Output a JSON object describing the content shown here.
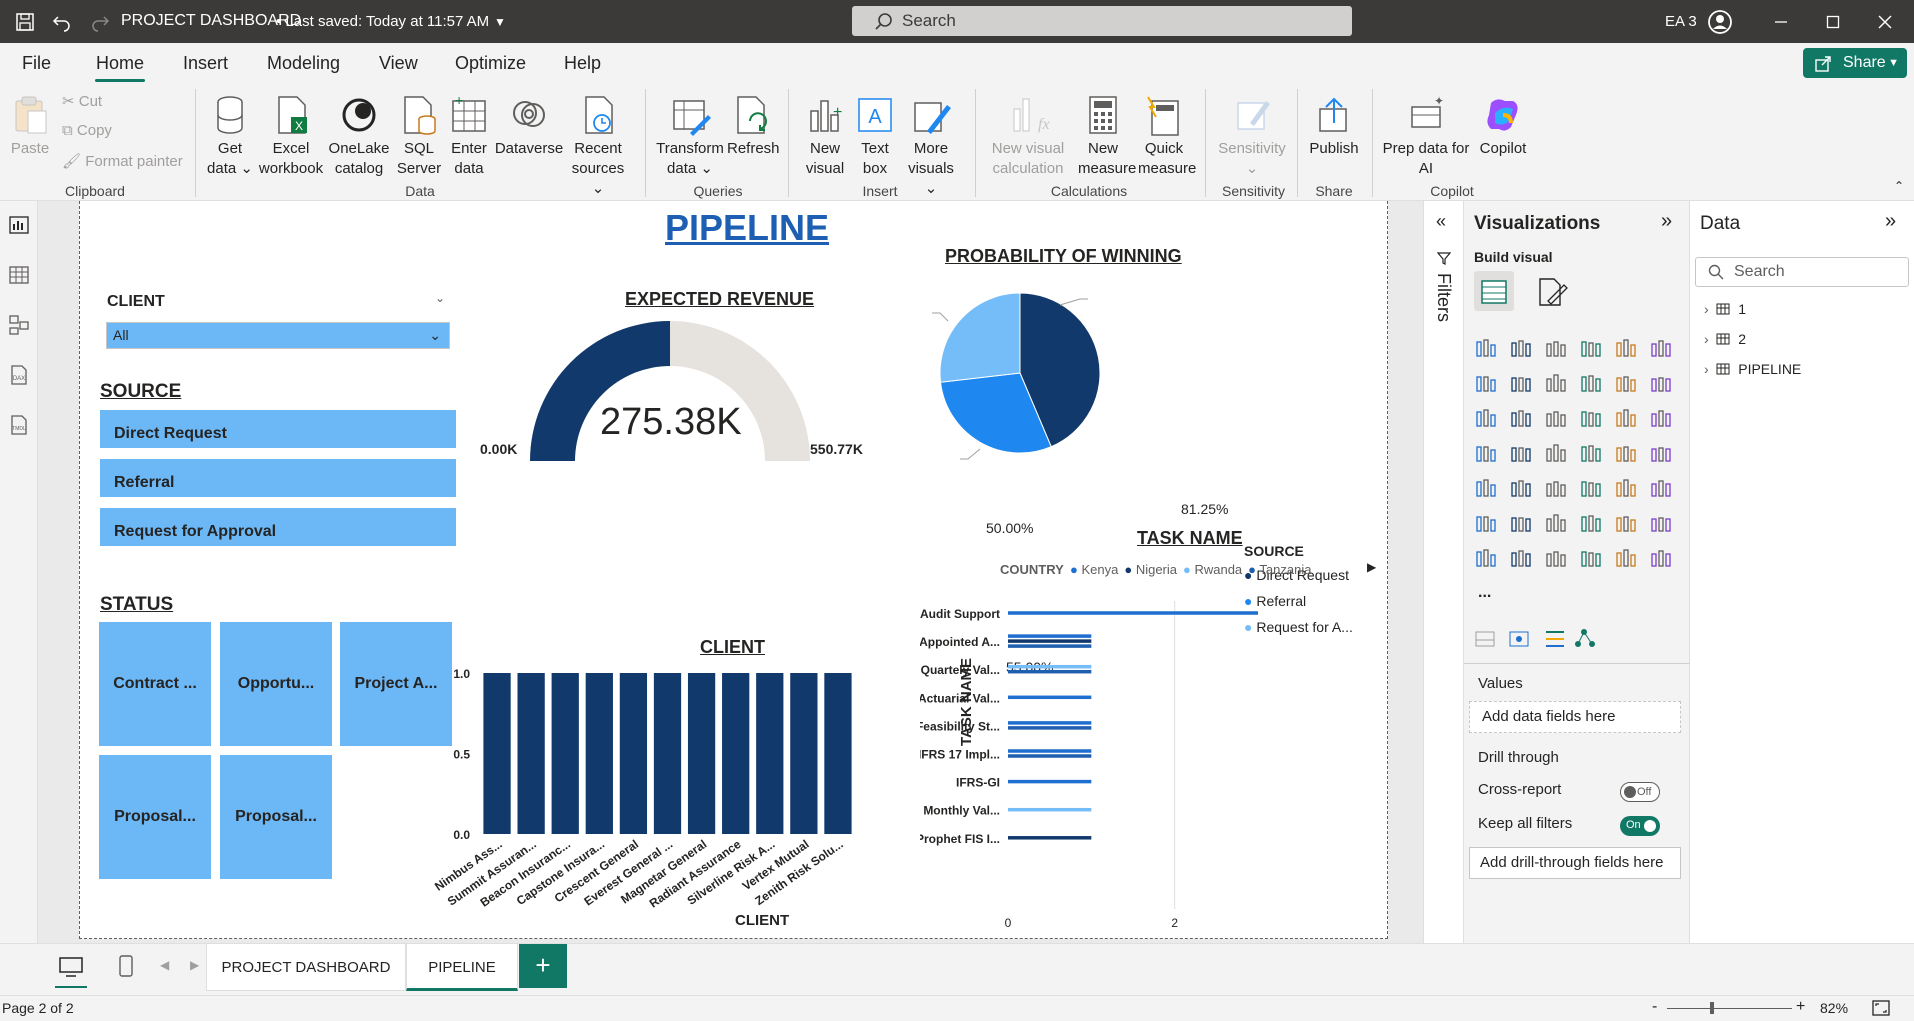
{
  "titlebar": {
    "title": "PROJECT DASHBOARD",
    "saved": "• Last saved: Today at 11:57 AM",
    "search_placeholder": "Search",
    "user": "EA 3"
  },
  "menu": {
    "items": [
      "File",
      "Home",
      "Insert",
      "Modeling",
      "View",
      "Optimize",
      "Help"
    ],
    "active": "Home",
    "share": "Share"
  },
  "ribbon": {
    "clipboard": {
      "paste": "Paste",
      "cut": "Cut",
      "copy": "Copy",
      "format_painter": "Format painter",
      "group": "Clipboard"
    },
    "data": {
      "get_data": "Get data",
      "excel": "Excel workbook",
      "onelake": "OneLake catalog",
      "sql": "SQL Server",
      "enter": "Enter data",
      "dataverse": "Dataverse",
      "recent": "Recent sources",
      "group": "Data"
    },
    "queries": {
      "transform": "Transform data",
      "refresh": "Refresh",
      "group": "Queries"
    },
    "insert": {
      "new_visual": "New visual",
      "text_box": "Text box",
      "more_visuals": "More visuals",
      "group": "Insert"
    },
    "calculations": {
      "new_visual_calc": "New visual calculation",
      "new_measure": "New measure",
      "quick_measure": "Quick measure",
      "group": "Calculations"
    },
    "sensitivity": {
      "sensitivity": "Sensitivity",
      "group": "Sensitivity"
    },
    "share": {
      "publish": "Publish",
      "group": "Share"
    },
    "copilot": {
      "prep": "Prep data for AI",
      "copilot": "Copilot",
      "group": "Copilot"
    }
  },
  "report": {
    "title": "PIPELINE",
    "client_slicer": {
      "label": "CLIENT",
      "value": "All"
    },
    "source_slicer": {
      "label": "SOURCE",
      "items": [
        "Direct Request",
        "Referral",
        "Request for Approval"
      ]
    },
    "status_slicer": {
      "label": "STATUS",
      "items": [
        "Contract ...",
        "Opportu...",
        "Project A...",
        "Proposal...",
        "Proposal..."
      ]
    },
    "gauge": {
      "title": "EXPECTED REVENUE",
      "value_label": "275.38K",
      "min_label": "0.00K",
      "max_label": "550.77K",
      "value": 275.38,
      "max": 550.77,
      "fill_color": "#12396b",
      "track_color": "#e6e2de"
    },
    "pie": {
      "title": "PROBABILITY OF WINNING",
      "legend_title": "SOURCE",
      "labels_text": [
        "81.25%",
        "55.00%",
        "50.00%"
      ],
      "legend": [
        "Direct Request",
        "Referral",
        "Request for A..."
      ]
    },
    "client_chart": {
      "title": "CLIENT",
      "xlabel": "CLIENT"
    },
    "task_chart": {
      "title": "TASK NAME",
      "ylabel": "TASK NAME",
      "legend_title": "COUNTRY"
    }
  },
  "chart_data": [
    {
      "type": "pie",
      "title": "PROBABILITY OF WINNING",
      "categories": [
        "Direct Request",
        "Referral",
        "Request for A..."
      ],
      "values": [
        81.25,
        55.0,
        50.0
      ],
      "colors": [
        "#12396b",
        "#1e88f0",
        "#74bdf9"
      ],
      "legend_position": "right"
    },
    {
      "type": "bar",
      "title": "CLIENT",
      "xlabel": "CLIENT",
      "ylabel": "",
      "categories": [
        "Nimbus Ass...",
        "Summit Assuran...",
        "Beacon Insuranc...",
        "Capstone Insura...",
        "Crescent General",
        "Everest General ...",
        "Magnetar General",
        "Radiant Assurance",
        "Silverline Risk A...",
        "Vertex Mutual",
        "Zenith Risk Solu..."
      ],
      "values": [
        1,
        1,
        1,
        1,
        1,
        1,
        1,
        1,
        1,
        1,
        1
      ],
      "yticks": [
        "0.0",
        "0.5",
        "1.0"
      ],
      "ylim": [
        0,
        1
      ],
      "color": "#12396b"
    },
    {
      "type": "bar",
      "orientation": "horizontal",
      "title": "TASK NAME",
      "ylabel": "TASK NAME",
      "categories": [
        "Audit Support",
        "Appointed A...",
        "Quartely Val...",
        "Actuarial Val...",
        "Feasibility St...",
        "IFRS 17 Impl...",
        "IFRS-GI",
        "Monthly Val...",
        "Prophet FIS I..."
      ],
      "xticks": [
        "0",
        "2"
      ],
      "xlim": [
        0,
        3
      ],
      "legend_position": "top",
      "series": [
        {
          "name": "Kenya",
          "color": "#1e6fd0",
          "values": [
            3,
            1,
            0,
            1,
            1,
            1,
            1,
            0,
            0
          ]
        },
        {
          "name": "Nigeria",
          "color": "#12396b",
          "values": [
            0,
            1,
            0,
            0,
            0,
            0,
            0,
            0,
            1
          ]
        },
        {
          "name": "Rwanda",
          "color": "#74bdf9",
          "values": [
            0,
            0,
            1,
            0,
            0,
            0,
            0,
            1,
            0
          ]
        },
        {
          "name": "Tanzania",
          "color": "#1f5fb0",
          "values": [
            0,
            1,
            1,
            0,
            1,
            1,
            0,
            0,
            0
          ]
        }
      ]
    }
  ],
  "visualizations": {
    "title": "Visualizations",
    "build": "Build visual",
    "values": "Values",
    "values_placeholder": "Add data fields here",
    "drill": "Drill through",
    "cross_report": "Cross-report",
    "cross_state": "Off",
    "keep_filters": "Keep all filters",
    "keep_state": "On",
    "drill_placeholder": "Add drill-through fields here",
    "more": "..."
  },
  "filters": {
    "label": "Filters"
  },
  "data_pane": {
    "title": "Data",
    "search_placeholder": "Search",
    "tables": [
      "1",
      "2",
      "PIPELINE"
    ]
  },
  "tabs": {
    "items": [
      "PROJECT DASHBOARD",
      "PIPELINE"
    ],
    "active": "PIPELINE",
    "add": "+"
  },
  "status": {
    "page": "Page 2 of 2",
    "zoom": "82%",
    "zoom_minus": "-",
    "zoom_plus": "+"
  }
}
